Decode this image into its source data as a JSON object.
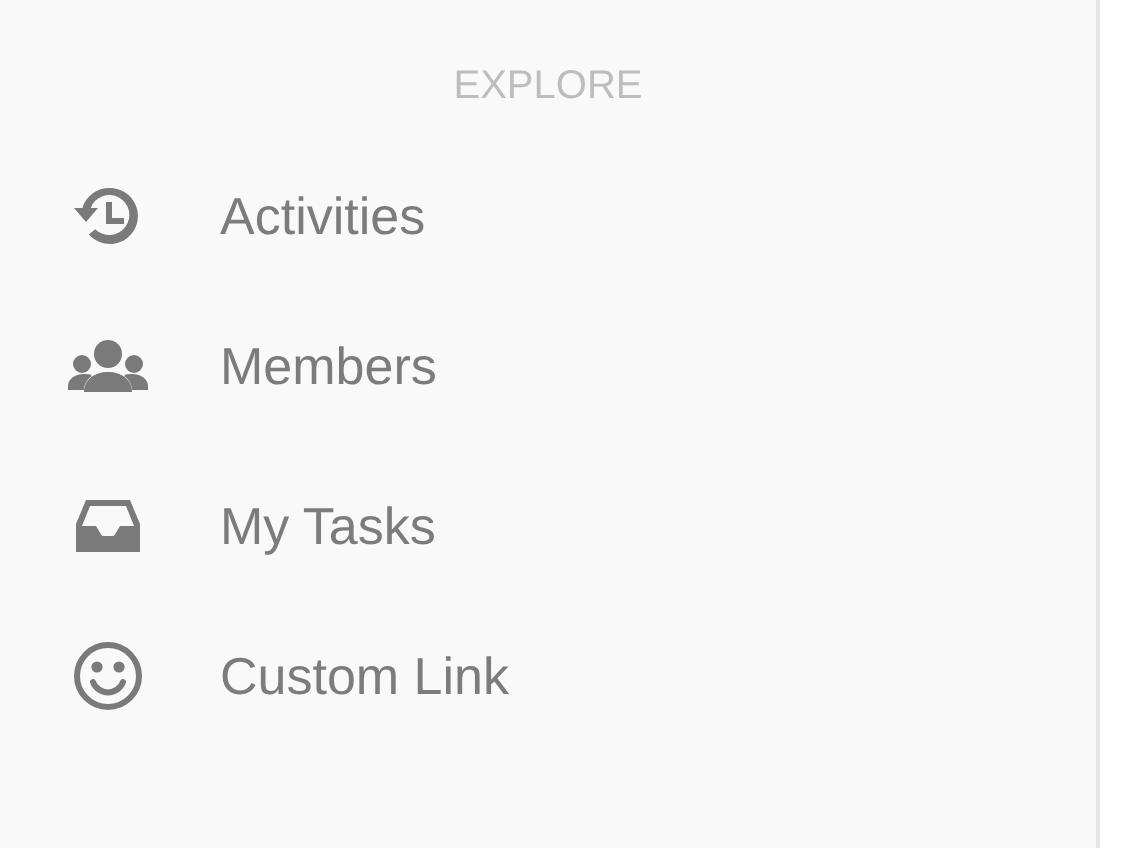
{
  "sidebar": {
    "heading": "EXPLORE",
    "items": [
      {
        "kind": "history",
        "label": "Activities"
      },
      {
        "kind": "members",
        "label": "Members"
      },
      {
        "kind": "inbox",
        "label": "My Tasks"
      },
      {
        "kind": "smiley",
        "label": "Custom Link"
      }
    ]
  }
}
